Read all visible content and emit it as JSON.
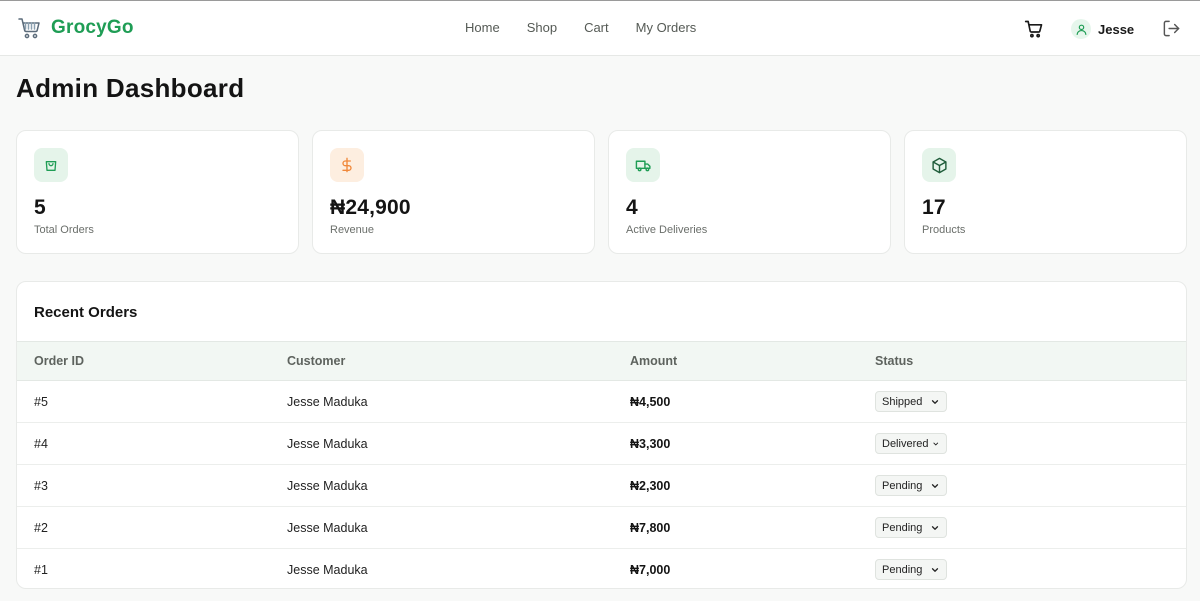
{
  "header": {
    "brand": "GrocyGo",
    "nav": [
      {
        "label": "Home"
      },
      {
        "label": "Shop"
      },
      {
        "label": "Cart"
      },
      {
        "label": "My Orders"
      }
    ],
    "user_name": "Jesse",
    "icons": {
      "brand": "shopping-cart-icon",
      "cart": "cart-icon",
      "user": "user-icon",
      "logout": "logout-icon"
    }
  },
  "page": {
    "title": "Admin Dashboard"
  },
  "stats": [
    {
      "value": "5",
      "label": "Total Orders",
      "icon": "shopping-bag-icon",
      "accent": "#1f9d55"
    },
    {
      "value": "₦24,900",
      "label": "Revenue",
      "icon": "dollar-icon",
      "accent": "#f0883a"
    },
    {
      "value": "4",
      "label": "Active Deliveries",
      "icon": "truck-icon",
      "accent": "#1f9d55"
    },
    {
      "value": "17",
      "label": "Products",
      "icon": "box-icon",
      "accent": "#1f9d55"
    }
  ],
  "orders": {
    "title": "Recent Orders",
    "columns": [
      "Order ID",
      "Customer",
      "Amount",
      "Status"
    ],
    "rows": [
      {
        "id": "#5",
        "customer": "Jesse Maduka",
        "amount": "₦4,500",
        "status": "Shipped"
      },
      {
        "id": "#4",
        "customer": "Jesse Maduka",
        "amount": "₦3,300",
        "status": "Delivered"
      },
      {
        "id": "#3",
        "customer": "Jesse Maduka",
        "amount": "₦2,300",
        "status": "Pending"
      },
      {
        "id": "#2",
        "customer": "Jesse Maduka",
        "amount": "₦7,800",
        "status": "Pending"
      },
      {
        "id": "#1",
        "customer": "Jesse Maduka",
        "amount": "₦7,000",
        "status": "Pending"
      }
    ]
  },
  "colors": {
    "brand": "#1f9d55",
    "header_bg": "#ffffff",
    "page_bg": "#f8f9f8",
    "table_header_bg": "#f2f7f3"
  }
}
